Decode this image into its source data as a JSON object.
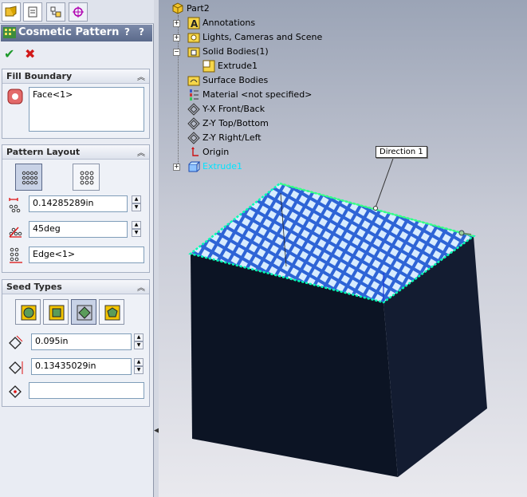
{
  "panel": {
    "title": "Cosmetic Pattern",
    "help_label": "?",
    "pin_label": "?",
    "tabs": [
      "property-manager",
      "configuration-manager",
      "dimxpert-manager",
      "display-manager"
    ]
  },
  "fill_boundary": {
    "header": "Fill Boundary",
    "selection": "Face<1>"
  },
  "pattern_layout": {
    "header": "Pattern Layout",
    "spacing": "0.14285289in",
    "angle": "45deg",
    "reference": "Edge<1>"
  },
  "seed_types": {
    "header": "Seed Types",
    "selected_index": 2,
    "dim1": "0.095in",
    "dim2": "0.13435029in",
    "dim3": ""
  },
  "tree": {
    "root": "Part2",
    "items": [
      {
        "label": "Annotations",
        "expandable": true
      },
      {
        "label": "Lights, Cameras and Scene",
        "expandable": true
      },
      {
        "label": "Solid Bodies(1)",
        "expandable": true,
        "expanded": true
      },
      {
        "label": "Extrude1",
        "child": true
      },
      {
        "label": "Surface Bodies",
        "expandable": false
      },
      {
        "label": "Material <not specified>",
        "expandable": false
      },
      {
        "label": "Y-X Front/Back",
        "expandable": false
      },
      {
        "label": "Z-Y Top/Bottom",
        "expandable": false
      },
      {
        "label": "Z-Y Right/Left",
        "expandable": false
      },
      {
        "label": "Origin",
        "expandable": false
      },
      {
        "label": "Extrude1",
        "expandable": true,
        "highlighted": true
      }
    ]
  },
  "callout": "Direction 1",
  "colors": {
    "title_bar": "#5b6a8b",
    "highlight": "#00c8ff",
    "pattern_fill": "#3a78e0",
    "model_dark": "#0d1526"
  }
}
